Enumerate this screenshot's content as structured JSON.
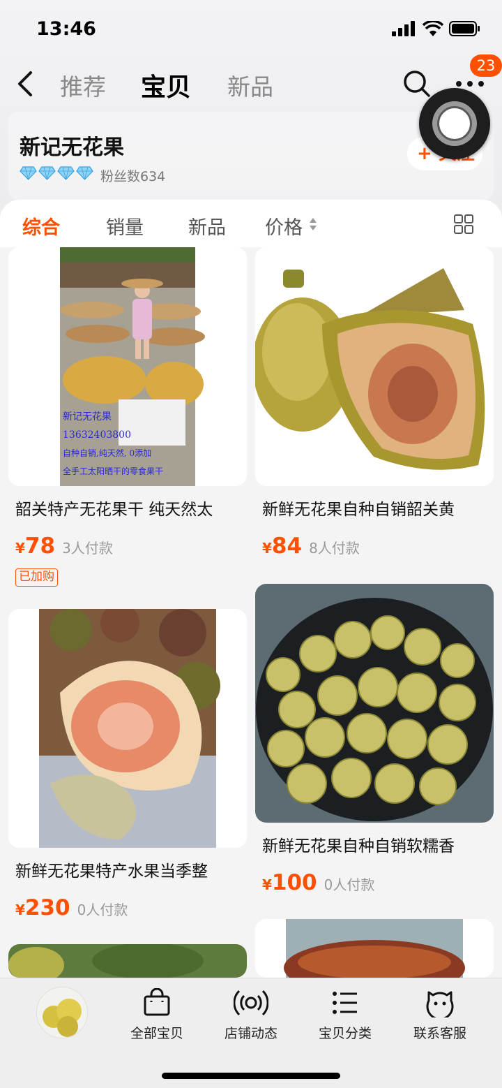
{
  "status_bar": {
    "time": "13:46"
  },
  "nav": {
    "tabs": [
      {
        "label": "推荐",
        "active": false
      },
      {
        "label": "宝贝",
        "active": true
      },
      {
        "label": "新品",
        "active": false
      }
    ],
    "badge_count": "23",
    "icons": [
      "back-arrow-icon",
      "search-icon",
      "more-dots-icon"
    ]
  },
  "store": {
    "name": "新记无花果",
    "diamond_count": 4,
    "fans_label": "粉丝数634",
    "follow_label": "+ 关注"
  },
  "sort_bar": {
    "items": [
      "综合",
      "销量",
      "新品",
      "价格"
    ],
    "active_index": 0
  },
  "products": [
    {
      "title": "韶关特产无花果干 纯天然太",
      "yen": "¥",
      "price": "78",
      "paid": "3人付款",
      "tag": "已加购",
      "image_text": [
        "新记无花果",
        "13632403800",
        "自种自销,纯天然, 0添加",
        "全手工太阳晒干的零食果干"
      ]
    },
    {
      "title": "新鲜无花果自种自销韶关黄",
      "yen": "¥",
      "price": "84",
      "paid": "8人付款",
      "tag": ""
    },
    {
      "title": "新鲜无花果特产水果当季整",
      "yen": "¥",
      "price": "230",
      "paid": "0人付款",
      "tag": ""
    },
    {
      "title": "新鲜无花果自种自销软糯香",
      "yen": "¥",
      "price": "100",
      "paid": "0人付款",
      "tag": ""
    }
  ],
  "bottom_tabs": [
    {
      "label": "全部宝贝",
      "icon": "bag-icon"
    },
    {
      "label": "店铺动态",
      "icon": "broadcast-icon"
    },
    {
      "label": "宝贝分类",
      "icon": "list-icon"
    },
    {
      "label": "联系客服",
      "icon": "chat-face-icon"
    }
  ],
  "colors": {
    "accent": "#ff5000",
    "diamond": "#6ec6f5"
  }
}
